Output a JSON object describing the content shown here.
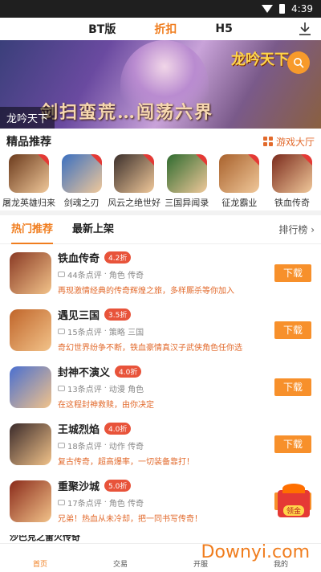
{
  "status": {
    "time": "4:39"
  },
  "top_nav": {
    "tabs": [
      "BT版",
      "折扣",
      "H5"
    ],
    "active": "折扣"
  },
  "banner": {
    "caption": "龙吟天下",
    "logo": "龙吟天下",
    "slogan": "剑扫蛮荒…闯荡六界"
  },
  "recommend": {
    "title": "精品推荐",
    "hall_label": "游戏大厅",
    "items": [
      {
        "name": "屠龙英雄归来",
        "color": "#6b3a1c"
      },
      {
        "name": "剑魂之刃",
        "color": "#3a6fc0"
      },
      {
        "name": "风云之绝世好",
        "color": "#3b2f2b"
      },
      {
        "name": "三国异闻录",
        "color": "#2e6b2f"
      },
      {
        "name": "征龙霸业",
        "color": "#a8612c"
      },
      {
        "name": "铁血传奇",
        "color": "#7a2a1c"
      }
    ]
  },
  "list_tabs": {
    "hot": "热门推荐",
    "new": "最新上架",
    "rank": "排行榜 ›"
  },
  "games": [
    {
      "name": "铁血传奇",
      "discount": "4.2折",
      "reviews": "44条点评",
      "tags": "角色 传奇",
      "desc": "再现激情经典的传奇辉煌之旅，多样厮杀等你加入",
      "btn": "下载",
      "color": "#8a3a24"
    },
    {
      "name": "遇见三国",
      "discount": "3.5折",
      "reviews": "15条点评",
      "tags": "策略 三国",
      "desc": "奇幻世界纷争不断，铁血豪情真汉子武侠角色任你选",
      "btn": "下载",
      "color": "#c0652a"
    },
    {
      "name": "封神不演义",
      "discount": "4.0折",
      "reviews": "13条点评",
      "tags": "动漫 角色",
      "desc": "在这程封神救赎，由你决定",
      "btn": "下载",
      "color": "#4a6fd0"
    },
    {
      "name": "王城烈焰",
      "discount": "4.0折",
      "reviews": "18条点评",
      "tags": "动作 传奇",
      "desc": "复古传奇，超高爆率，一切装备靠打！",
      "btn": "下载",
      "color": "#3a2a2a"
    },
    {
      "name": "重聚沙城",
      "discount": "5.0折",
      "reviews": "17条点评",
      "tags": "角色 传奇",
      "desc": "兄弟！热血从未冷却，把一同书写传奇！",
      "btn": "下载",
      "color": "#8a2a1a"
    }
  ],
  "partial_game": "沙巴克之雷火传奇",
  "float_gift": {
    "label": "领金"
  },
  "bottom_nav": [
    "首页",
    "交易",
    "开服",
    "我的"
  ],
  "watermark": "Downyi.com"
}
